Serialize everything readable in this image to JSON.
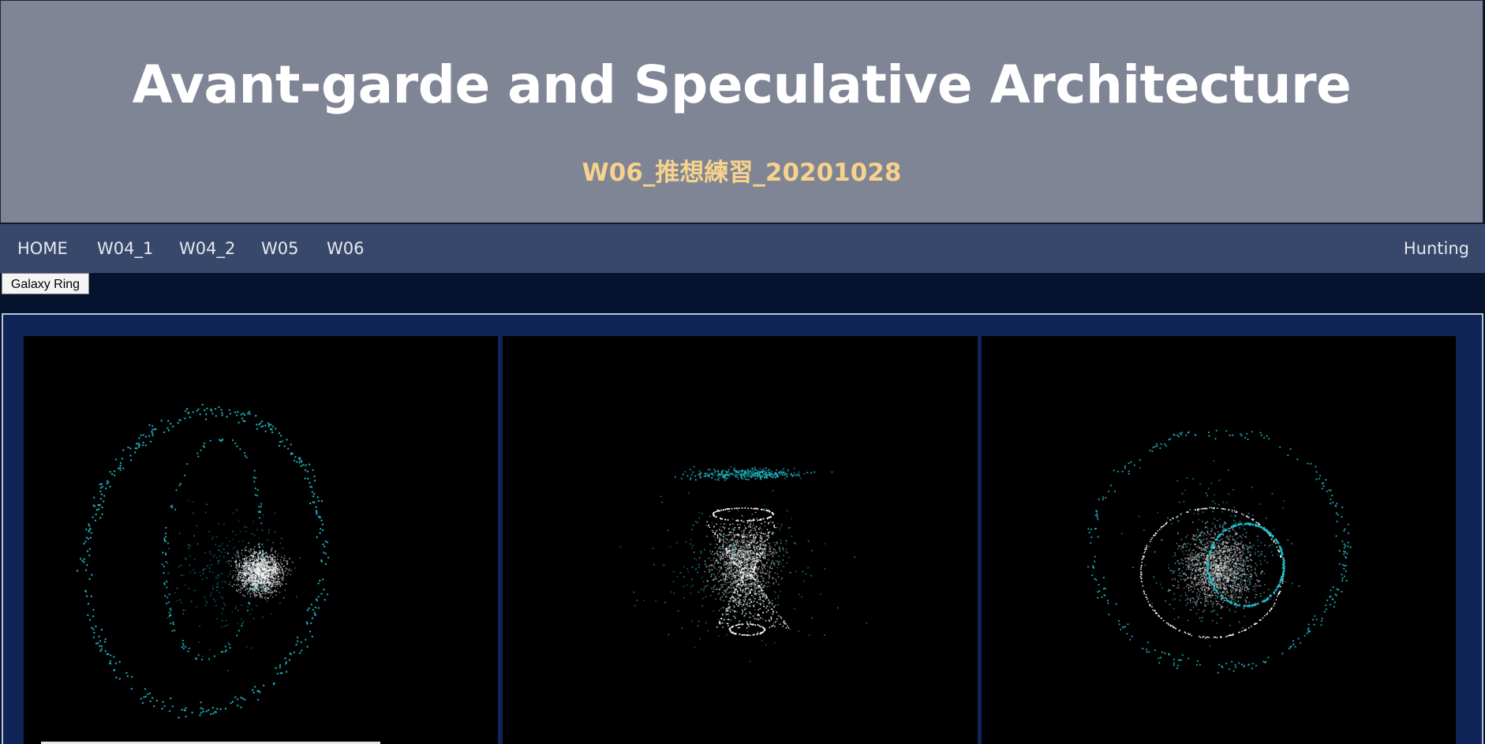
{
  "header": {
    "title": "Avant-garde and Speculative Architecture",
    "subtitle": "W06_推想練習_20201028"
  },
  "nav": {
    "items": [
      "HOME",
      "W04_1",
      "W04_2",
      "W05",
      "W06"
    ],
    "right_item": "Hunting"
  },
  "tab": {
    "label": "Galaxy Ring"
  },
  "views": [
    {
      "name": "galaxy-view-side",
      "particle_colors": [
        "#ffffff",
        "#1fb9c9"
      ]
    },
    {
      "name": "galaxy-view-hourglass",
      "particle_colors": [
        "#ffffff",
        "#1fb9c9"
      ]
    },
    {
      "name": "galaxy-view-top",
      "particle_colors": [
        "#ffffff",
        "#1fb9c9"
      ]
    }
  ],
  "colors": {
    "header_bg": "#7f8594",
    "nav_bg": "#38486a",
    "subtitle": "#f6d28c",
    "page_bg": "#06132e",
    "panel_bg": "#0f2557",
    "cyan": "#1fb9c9"
  }
}
